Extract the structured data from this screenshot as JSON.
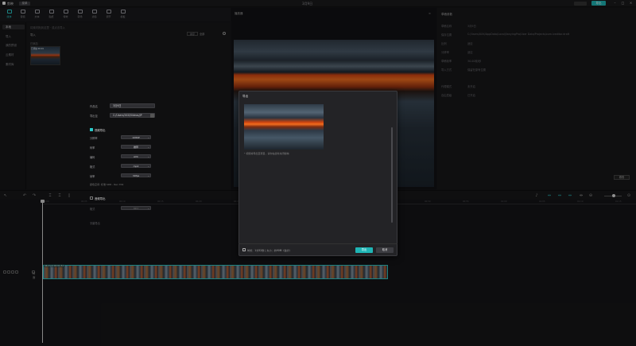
{
  "titlebar": {
    "app_name": "剪映",
    "menu_label": "菜单",
    "doc_title": "3月9日",
    "export_label": "导出",
    "minimize": "–",
    "maximize": "□",
    "close": "×"
  },
  "toolbar": {
    "items": [
      {
        "label": "媒体",
        "icon": "media-icon"
      },
      {
        "label": "音频",
        "icon": "audio-icon"
      },
      {
        "label": "文本",
        "icon": "text-icon"
      },
      {
        "label": "贴纸",
        "icon": "sticker-icon"
      },
      {
        "label": "特效",
        "icon": "effects-icon"
      },
      {
        "label": "转场",
        "icon": "transition-icon"
      },
      {
        "label": "滤镜",
        "icon": "filter-icon"
      },
      {
        "label": "调节",
        "icon": "adjust-icon"
      },
      {
        "label": "模板",
        "icon": "template-icon"
      }
    ]
  },
  "leftnav": {
    "items": [
      "本地",
      "导入",
      "我的预设",
      "云素材",
      "素材库"
    ]
  },
  "media": {
    "crumbs": "将素材拖到这里 · 或点击导入",
    "import_label": "导入",
    "sort_label": "排序",
    "filter_label": "全部",
    "added_label": "已添加",
    "thumb_label": "已添加 00:01"
  },
  "player": {
    "title": "播放器",
    "menu": "≡"
  },
  "details": {
    "title": "草稿参数",
    "rows": [
      {
        "k": "草稿名称",
        "v": "3月9日"
      },
      {
        "k": "保存位置",
        "v": "C:/Users/XXX/AppData/Local/JianyingPro/User Data/Projects/com.lveditor.draft"
      },
      {
        "k": "比例",
        "v": "适应"
      },
      {
        "k": "分辨率",
        "v": "适应"
      },
      {
        "k": "草稿帧率",
        "v": "30.00帧/秒"
      },
      {
        "k": "导入方式",
        "v": "保留在原有位置"
      },
      {
        "k": "代理模式",
        "v": "未开启"
      },
      {
        "k": "自由层级",
        "v": "已开启"
      }
    ],
    "modify_label": "修改"
  },
  "timeline": {
    "ticks": [
      "00:00",
      "00:05",
      "00:10",
      "00:15",
      "00:20",
      "00:25",
      "00:30",
      "00:35",
      "00:40",
      "00:45",
      "00:50",
      "00:55",
      "01:00",
      "01:05",
      "01:10",
      "01:15",
      "01:20",
      "01:25",
      "01:30"
    ],
    "track_name": "封面",
    "clip_label": "4K.mp4 00:01:52"
  },
  "export_dialog": {
    "title": "导出",
    "preview_note": "* 视频将导出至项目，请勿在此时关闭剪映",
    "name_label": "作品名",
    "name_value": "3月9日",
    "path_label": "导出至",
    "path_value": "C:/Users/XXX/Videos/JP",
    "video_section": "视频导出",
    "options": [
      {
        "label": "分辨率",
        "value": "1080P"
      },
      {
        "label": "码率",
        "value": "推荐"
      },
      {
        "label": "编码",
        "value": "AVC"
      },
      {
        "label": "格式",
        "value": "mp4"
      },
      {
        "label": "帧率",
        "value": "30fps"
      }
    ],
    "estimate": "颜色空间: 标准 SDR - Rec.709",
    "audio_section": "音频导出",
    "audio_option": {
      "label": "格式",
      "value": "MP3"
    },
    "extra_section": "字幕导出",
    "info": "时长：1分52秒 | 大小：约90M（估计）",
    "export_btn": "导出",
    "cancel_btn": "取消"
  }
}
